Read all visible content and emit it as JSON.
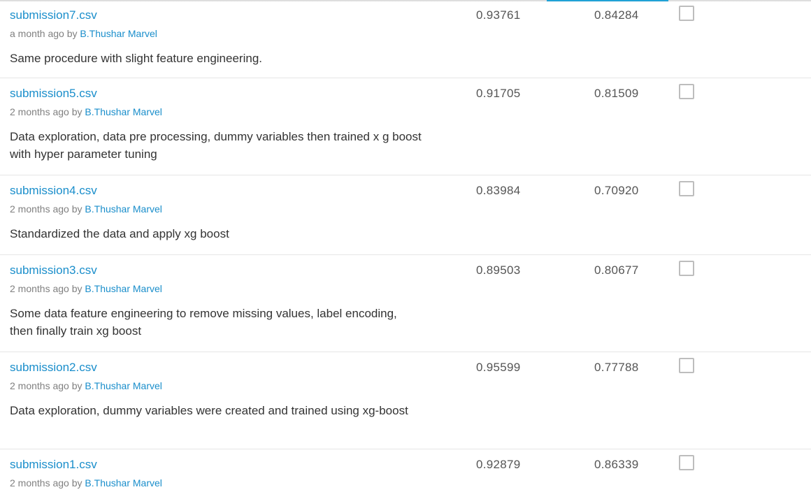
{
  "submissions": [
    {
      "file": "submission7.csv",
      "time": "a month ago",
      "by": "by",
      "author": "B.Thushar Marvel",
      "description": "Same procedure with slight feature engineering.",
      "private_score": "0.93761",
      "public_score": "0.84284",
      "selected": false
    },
    {
      "file": "submission5.csv",
      "time": "2 months ago",
      "by": "by",
      "author": "B.Thushar Marvel",
      "description": "Data exploration, data pre processing, dummy variables then trained x g boost with hyper parameter tuning",
      "private_score": "0.91705",
      "public_score": "0.81509",
      "selected": false
    },
    {
      "file": "submission4.csv",
      "time": "2 months ago",
      "by": "by",
      "author": "B.Thushar Marvel",
      "description": "Standardized the data and apply xg boost",
      "private_score": "0.83984",
      "public_score": "0.70920",
      "selected": false
    },
    {
      "file": "submission3.csv",
      "time": "2 months ago",
      "by": "by",
      "author": "B.Thushar Marvel",
      "description": "Some data feature engineering to remove missing values, label encoding, then finally train xg boost",
      "private_score": "0.89503",
      "public_score": "0.80677",
      "selected": false
    },
    {
      "file": "submission2.csv",
      "time": "2 months ago",
      "by": "by",
      "author": "B.Thushar Marvel",
      "description": "Data exploration, dummy variables were created and trained using xg-boost",
      "private_score": "0.95599",
      "public_score": "0.77788",
      "selected": false
    },
    {
      "file": "submission1.csv",
      "time": "2 months ago",
      "by": "by",
      "author": "B.Thushar Marvel",
      "description": "",
      "private_score": "0.92879",
      "public_score": "0.86339",
      "selected": false
    }
  ],
  "colors": {
    "link": "#1a8ecb",
    "tab_indicator": "#1fa1d6",
    "divider": "#e6e6e6"
  }
}
